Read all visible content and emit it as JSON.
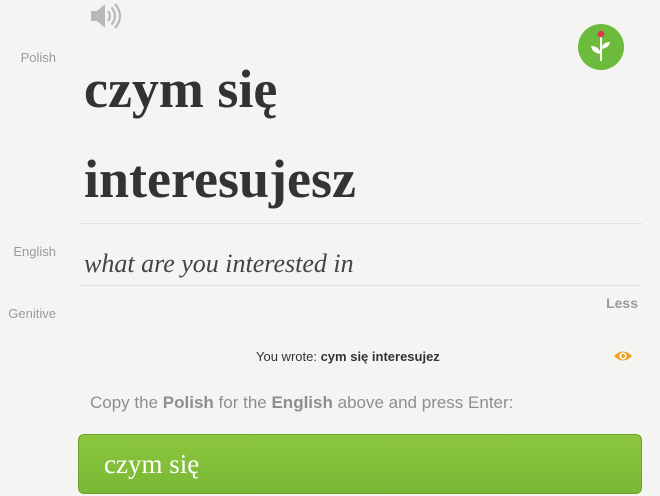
{
  "labels": {
    "polish": "Polish",
    "english": "English",
    "genitive": "Genitive"
  },
  "prompt": {
    "line1": "czym się",
    "line2": "interesujesz",
    "translation": "what are you interested in"
  },
  "controls": {
    "less_label": "Less"
  },
  "feedback": {
    "prefix": "You wrote:",
    "user_answer": "cym się interesujez"
  },
  "instruction": {
    "part1": "Copy the",
    "polish": "Polish",
    "part2": "for the",
    "english": "English",
    "part3": "above and press Enter:"
  },
  "answer_input": {
    "value": "czym się"
  },
  "colors": {
    "accent_green": "#8cc63f",
    "eye_orange": "#f0a020",
    "background": "#f4f4f2"
  },
  "icons": {
    "audio": "speaker-icon",
    "logo": "flower-logo-icon",
    "reveal": "eye-icon"
  }
}
